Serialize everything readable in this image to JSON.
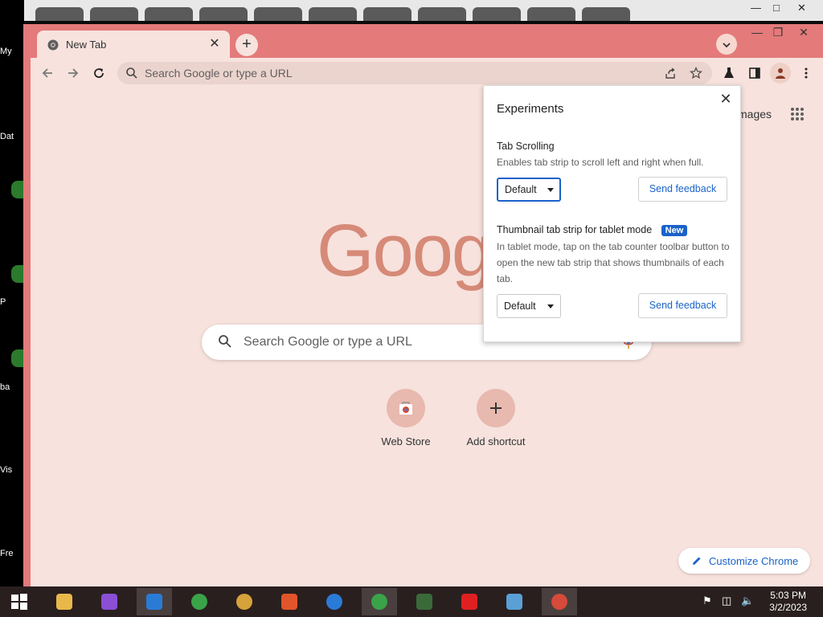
{
  "desktop": {
    "icons": [
      {
        "label": "My"
      },
      {
        "label": "Dat"
      },
      {
        "label": "("
      },
      {
        "label": "P"
      },
      {
        "label": "ba"
      },
      {
        "label": "Vis"
      },
      {
        "label": "Fre"
      }
    ]
  },
  "browser": {
    "tab": {
      "title": "New Tab"
    },
    "omnibox": {
      "placeholder": "Search Google or type a URL"
    }
  },
  "ntp": {
    "images_link": "mages",
    "logo_text": "Goog",
    "search_placeholder": "Search Google or type a URL",
    "shortcuts": [
      {
        "label": "Web Store"
      },
      {
        "label": "Add shortcut"
      }
    ],
    "customize_label": "Customize Chrome"
  },
  "experiments": {
    "title": "Experiments",
    "items": [
      {
        "name": "Tab Scrolling",
        "description": "Enables tab strip to scroll left and right when full.",
        "select_value": "Default",
        "feedback_label": "Send feedback"
      },
      {
        "name": "Thumbnail tab strip for tablet mode",
        "badge": "New",
        "description": "In tablet mode, tap on the tab counter toolbar button to open the new tab strip that shows thumbnails of each tab.",
        "select_value": "Default",
        "feedback_label": "Send feedback"
      }
    ]
  },
  "taskbar": {
    "time": "5:03 PM",
    "date": "3/2/2023",
    "apps": [
      {
        "icon": "file-explorer-icon",
        "color": "#e8b84a"
      },
      {
        "icon": "visual-studio-icon",
        "color": "#8a4fd6"
      },
      {
        "icon": "tools-icon",
        "color": "#2a7bd6"
      },
      {
        "icon": "chrome-icon",
        "color": "#3aa34a"
      },
      {
        "icon": "chrome-canary-icon",
        "color": "#d6a23a"
      },
      {
        "icon": "brave-icon",
        "color": "#e2552a"
      },
      {
        "icon": "chrome-beta-icon",
        "color": "#2a7bd6"
      },
      {
        "icon": "chrome-dev-icon",
        "color": "#3aa34a"
      },
      {
        "icon": "terminal-icon",
        "color": "#3a6a3a"
      },
      {
        "icon": "youtube-icon",
        "color": "#e02020"
      },
      {
        "icon": "paint-icon",
        "color": "#5aa0d6"
      },
      {
        "icon": "chrome-profile-icon",
        "color": "#d64a3a"
      }
    ]
  },
  "colors": {
    "accent": "#1a62c9",
    "frame": "#e47a7a",
    "surface": "#f7e2dd"
  }
}
